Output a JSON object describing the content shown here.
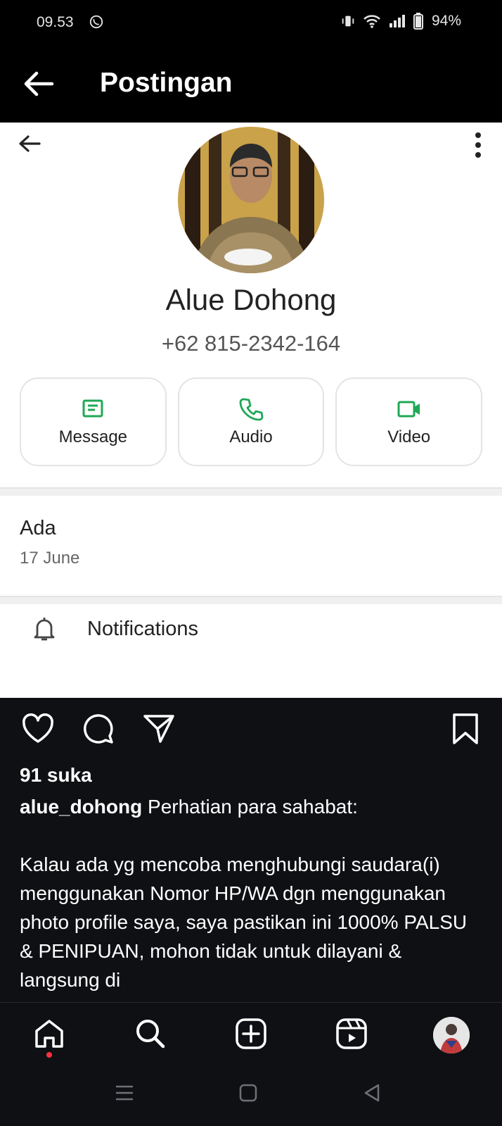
{
  "status_bar": {
    "time": "09.53",
    "battery": "94%",
    "icons": [
      "whatsapp-icon",
      "vibrate-icon",
      "wifi-icon",
      "signal-icon",
      "battery-icon"
    ]
  },
  "app_bar": {
    "title": "Postingan"
  },
  "contact": {
    "name": "Alue Dohong",
    "phone": "+62 815-2342-164",
    "actions": [
      {
        "label": "Message",
        "icon": "message-icon"
      },
      {
        "label": "Audio",
        "icon": "phone-icon"
      },
      {
        "label": "Video",
        "icon": "video-icon"
      }
    ],
    "about_status": "Ada",
    "about_date": "17 June",
    "notifications_label": "Notifications",
    "accent": "#1fa855"
  },
  "post": {
    "likes": "91 suka",
    "username": "alue_dohong",
    "caption_first": " Perhatian para sahabat:",
    "caption_body": "Kalau ada yg mencoba menghubungi saudara(i) menggunakan Nomor HP/WA dgn menggunakan photo profile saya, saya pastikan ini 1000% PALSU & PENIPUAN, mohon tidak untuk dilayani & langsung di"
  },
  "bottom_nav": {
    "items": [
      "home-icon",
      "search-icon",
      "create-icon",
      "reels-icon",
      "profile-avatar"
    ]
  },
  "system_nav": [
    "recents-icon",
    "home-square-icon",
    "back-triangle-icon"
  ]
}
